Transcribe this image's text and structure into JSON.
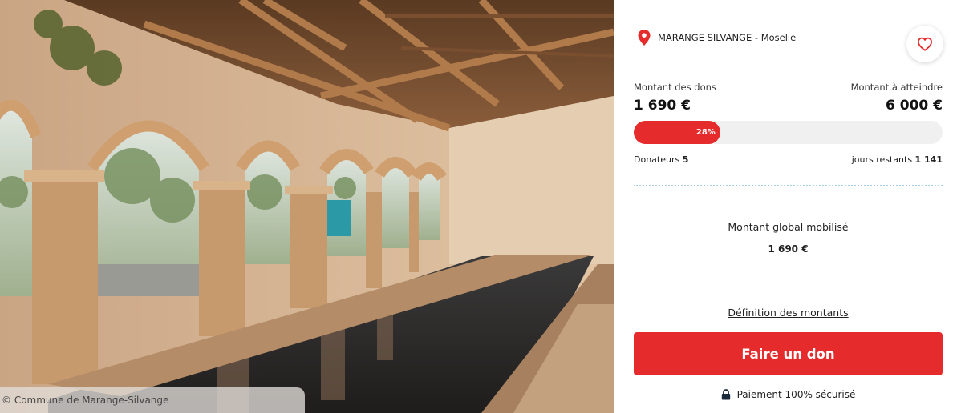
{
  "photo": {
    "alt": "Lavoir couvert en pierre avec arcades et bassin",
    "credit": "© Commune de Marange-Silvange"
  },
  "location": {
    "city": "MARANGE SILVANGE",
    "separator": " - ",
    "region": "Moselle",
    "icon": "map-pin-icon"
  },
  "favorite": {
    "icon": "heart-icon"
  },
  "funding": {
    "raised_label": "Montant des dons",
    "raised_value": "1 690 €",
    "goal_label": "Montant à atteindre",
    "goal_value": "6 000 €",
    "progress_percent": 28,
    "progress_text": "28%",
    "donors_label": "Donateurs",
    "donors_value": "5",
    "days_label": "jours restants",
    "days_value": "1 141"
  },
  "global": {
    "label": "Montant global mobilisé",
    "value": "1 690 €"
  },
  "definition_link": "Définition des montants",
  "donate_button": "Faire un don",
  "secure": {
    "text": "Paiement 100% sécurisé",
    "icon": "lock-icon"
  },
  "colors": {
    "accent": "#e52b2b",
    "divider": "#a9cfe8",
    "track": "#f0f0f0"
  }
}
